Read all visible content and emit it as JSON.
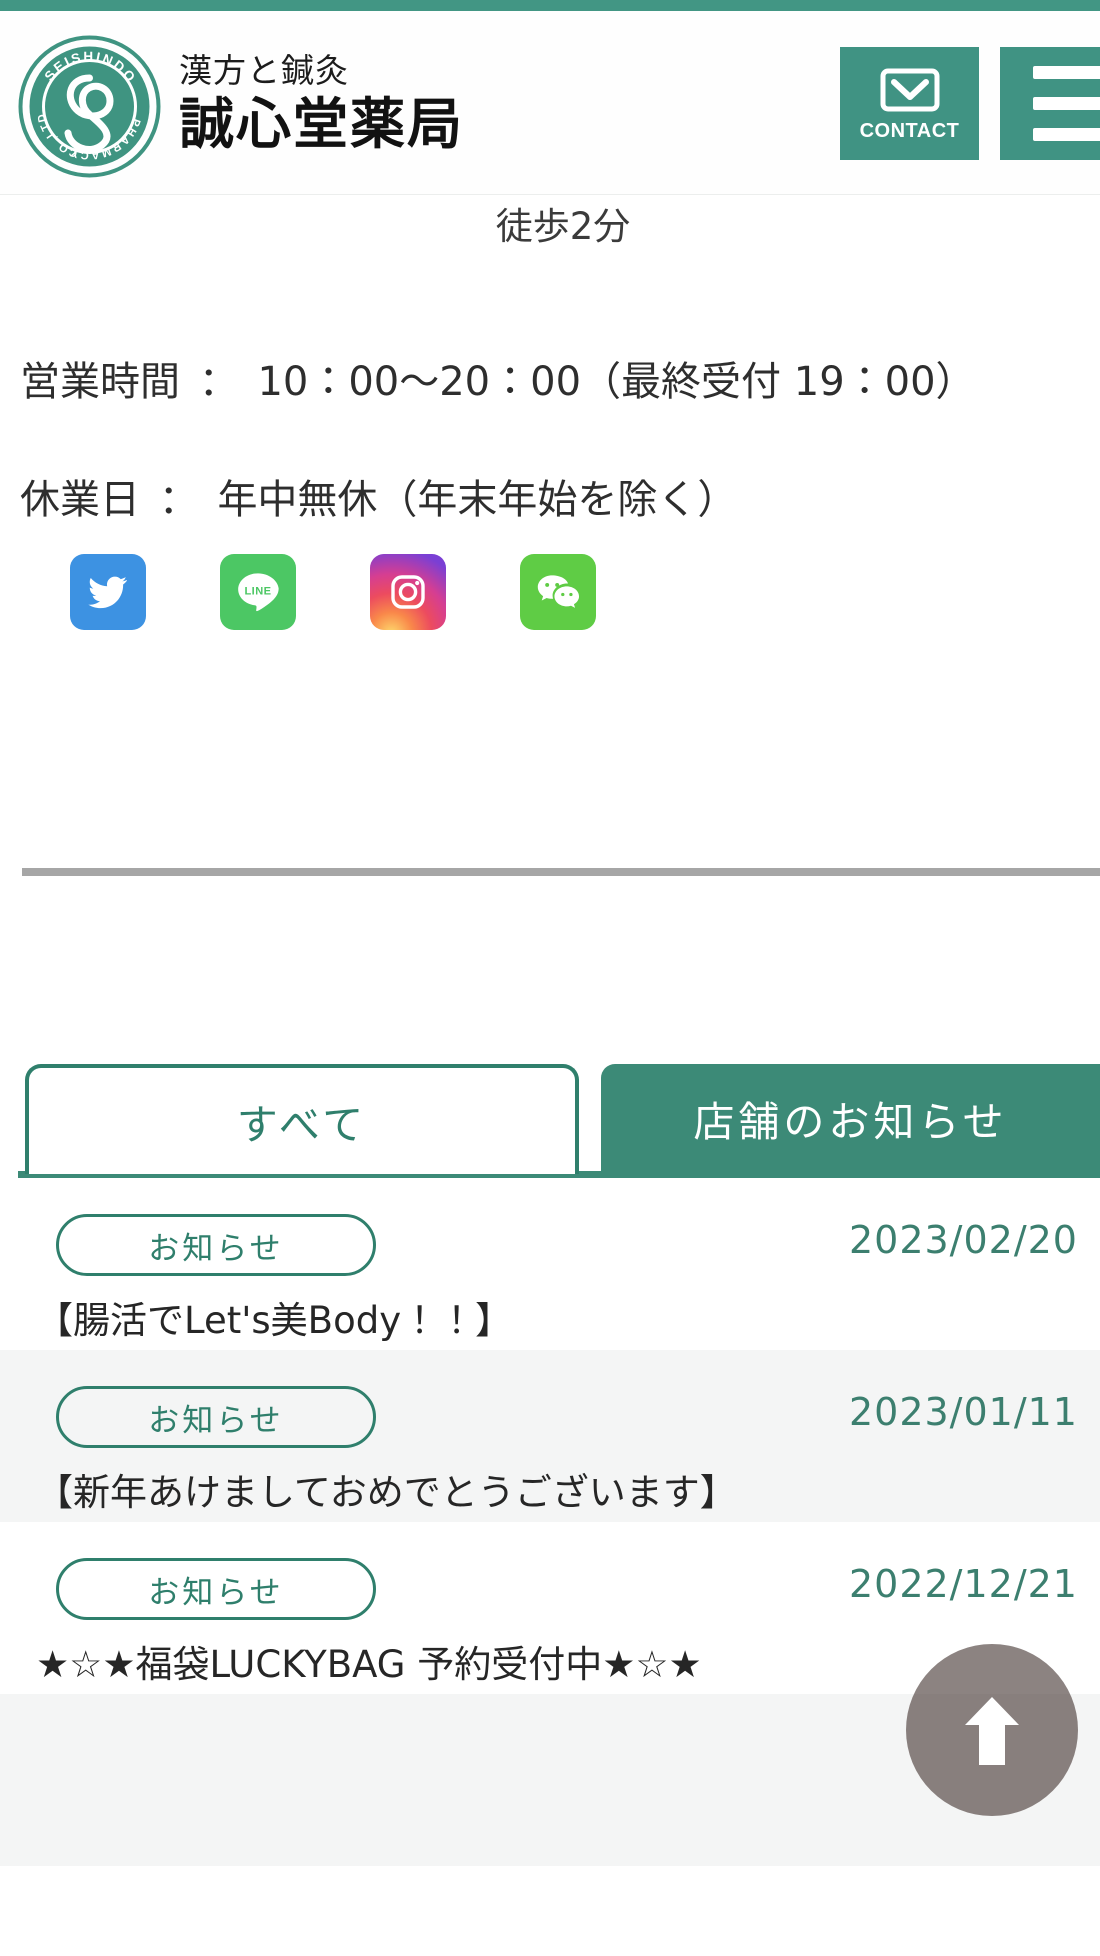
{
  "theme": {
    "brand_green": "#429684",
    "button_green": "#409383",
    "tab_green": "#3c8a77",
    "badge_green": "#2f7f6c",
    "date_green": "#3c7f6f",
    "alt_row_bg": "#f4f5f5",
    "divider_gray": "#a6a6a6",
    "scrolltop_bg": "rgba(70,55,52,0.62)"
  },
  "header": {
    "logo": {
      "icon": "seishindo-seal-logo",
      "ring_text_top": "SEISHINDO",
      "ring_text_right": "PHARMACY",
      "ring_text_bottom": "CO.,LTD."
    },
    "brand_sub": "漢方と鍼灸",
    "brand_main": "誠心堂薬局",
    "contact": {
      "icon": "envelope-icon",
      "label": "CONTACT"
    },
    "menu": {
      "icon": "hamburger-menu-icon"
    }
  },
  "info": {
    "access": "徒歩2分",
    "rows": [
      {
        "label": "営業時間",
        "separator": "：",
        "value": "10：00〜20：00（最終受付 19：00）"
      },
      {
        "label": "休業日",
        "separator": "：",
        "value": "年中無休（年末年始を除く）"
      }
    ]
  },
  "social": [
    {
      "name": "twitter-icon",
      "label": "Twitter",
      "color": "#3d92e2"
    },
    {
      "name": "line-icon",
      "label": "LINE",
      "color": "#4cc764"
    },
    {
      "name": "instagram-icon",
      "label": "Instagram",
      "color": "#d53e92"
    },
    {
      "name": "wechat-icon",
      "label": "WeChat",
      "color": "#5fcc45"
    }
  ],
  "news": {
    "tabs": [
      {
        "label": "すべて",
        "active": true
      },
      {
        "label": "店舗のお知らせ",
        "active": false
      }
    ],
    "items": [
      {
        "badge": "お知らせ",
        "date": "2023/02/20",
        "title": "【腸活でLet's美Body！！】"
      },
      {
        "badge": "お知らせ",
        "date": "2023/01/11",
        "title": "【新年あけましておめでとうございます】"
      },
      {
        "badge": "お知らせ",
        "date": "2022/12/21",
        "title": "★☆★福袋LUCKYBAG 予約受付中★☆★"
      }
    ]
  },
  "scroll_top": {
    "icon": "arrow-up-icon",
    "label": "ページトップへ戻る"
  }
}
